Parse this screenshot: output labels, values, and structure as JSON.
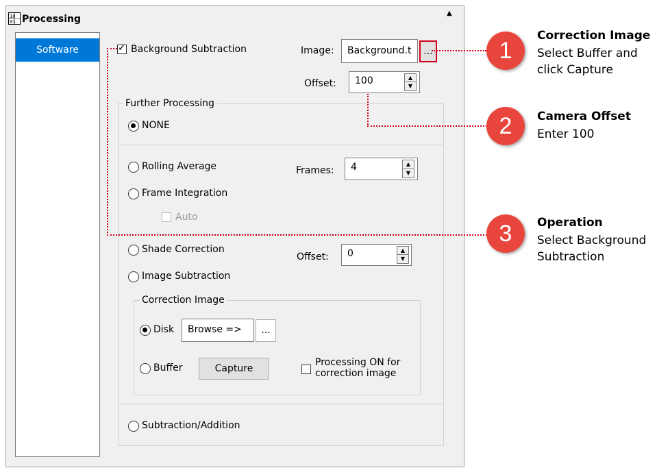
{
  "panel": {
    "title": "Processing",
    "icon": "grid-icon"
  },
  "sidebar": {
    "items": [
      {
        "label": "Software",
        "selected": true
      }
    ]
  },
  "background_subtraction": {
    "label": "Background Subtraction",
    "checked": true
  },
  "image_field": {
    "label": "Image:",
    "value": "Background.t",
    "browse_label": "..."
  },
  "offset_top": {
    "label": "Offset:",
    "value": "100"
  },
  "further_processing": {
    "title": "Further Processing",
    "none": {
      "label": "NONE",
      "selected": true
    },
    "rolling_average": {
      "label": "Rolling Average"
    },
    "frame_integration": {
      "label": "Frame Integration"
    },
    "frames": {
      "label": "Frames:",
      "value": "4"
    },
    "auto": {
      "label": "Auto",
      "enabled": false
    },
    "shade_correction": {
      "label": "Shade Correction"
    },
    "image_subtraction": {
      "label": "Image Subtraction"
    },
    "shade_offset": {
      "label": "Offset:",
      "value": "0"
    },
    "correction_image": {
      "title": "Correction Image",
      "disk": {
        "label": "Disk",
        "selected": true
      },
      "disk_field": "Browse =>",
      "disk_browse": "...",
      "buffer": {
        "label": "Buffer"
      },
      "capture_button": "Capture",
      "processing_on": {
        "line1": "Processing ON for",
        "line2": "correction image"
      }
    },
    "subtraction_addition": {
      "label": "Subtraction/Addition"
    }
  },
  "callouts": [
    {
      "number": "1",
      "title": "Correction Image",
      "lines": [
        "Select Buffer and",
        "click Capture"
      ]
    },
    {
      "number": "2",
      "title": "Camera Offset",
      "lines": [
        "Enter 100"
      ]
    },
    {
      "number": "3",
      "title": "Operation",
      "lines": [
        "Select Background",
        "Subtraction"
      ]
    }
  ],
  "colors": {
    "accent": "#0078d7",
    "callout": "#e8453c",
    "dotted_line": "#d0021b"
  }
}
